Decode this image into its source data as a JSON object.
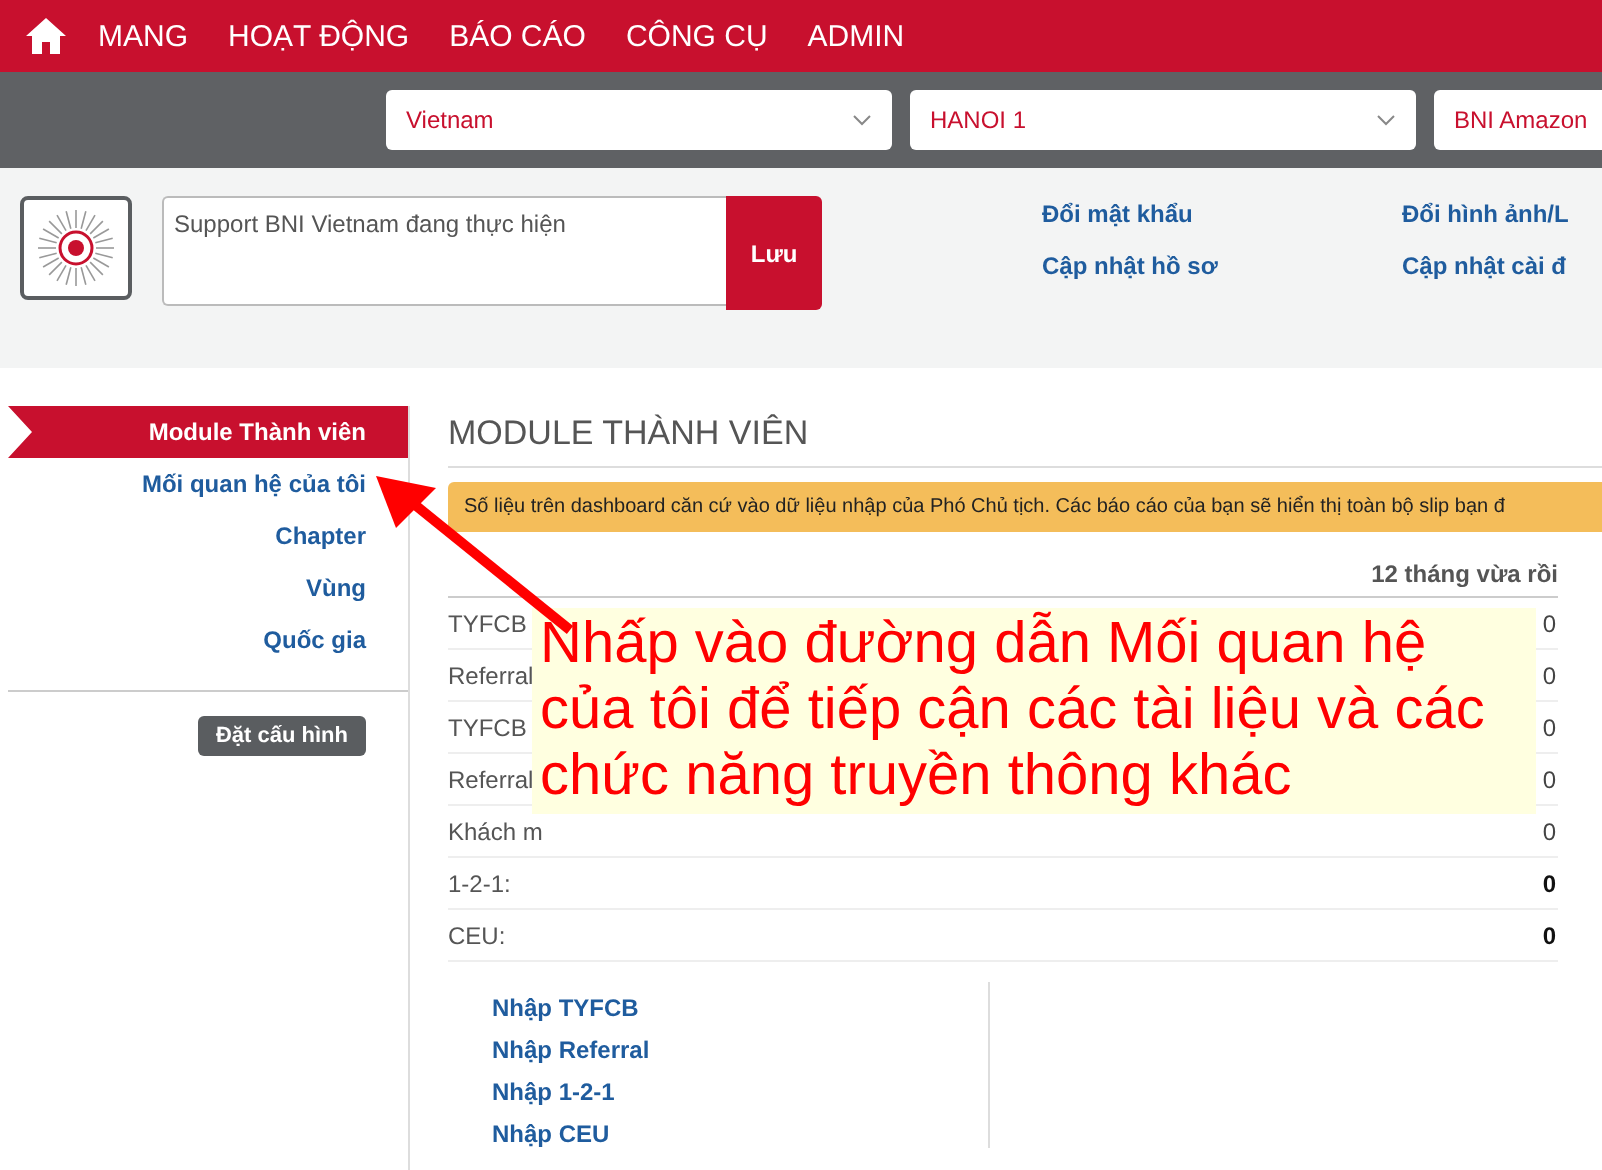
{
  "nav": {
    "items": [
      "MANG",
      "HOẠT ĐỘNG",
      "BÁO CÁO",
      "CÔNG CỤ",
      "ADMIN"
    ]
  },
  "selectors": [
    {
      "value": "Vietnam"
    },
    {
      "value": "HANOI 1"
    },
    {
      "value": "BNI Amazon"
    }
  ],
  "profile": {
    "status_value": "Support BNI Vietnam đang thực hiện",
    "save_button": "Lưu",
    "links": [
      "Đổi mật khẩu",
      "Đổi hình ảnh/L",
      "Cập nhật hồ sơ",
      "Cập nhật cài đ"
    ]
  },
  "sidebar": {
    "items": [
      {
        "label": "Module Thành viên",
        "selected": true
      },
      {
        "label": "Mối quan hệ của tôi",
        "selected": false
      },
      {
        "label": "Chapter",
        "selected": false
      },
      {
        "label": "Vùng",
        "selected": false
      },
      {
        "label": "Quốc gia",
        "selected": false
      }
    ],
    "config_button": "Đặt cấu hình"
  },
  "main": {
    "title": "MODULE THÀNH VIÊN",
    "notice": "Số liệu trên dashboard căn cứ vào dữ liệu nhập của Phó Chủ tịch. Các báo cáo của bạn sẽ hiển thị toàn bộ slip bạn đ",
    "table": {
      "column_header": "12 tháng vừa rồi",
      "rows": [
        {
          "label": "TYFCB",
          "value": "0"
        },
        {
          "label": "Referral",
          "value": "0"
        },
        {
          "label": "TYFCB",
          "value": "0"
        },
        {
          "label": "Referral",
          "value": "0"
        },
        {
          "label": "Khách m",
          "value": "0"
        },
        {
          "label": "1-2-1:",
          "value": "0"
        },
        {
          "label": "CEU:",
          "value": "0"
        }
      ]
    },
    "entry_links": [
      "Nhập TYFCB",
      "Nhập Referral",
      "Nhập 1-2-1",
      "Nhập CEU"
    ]
  },
  "annotation": {
    "text": "Nhấp vào đường dẫn Mối quan hệ của tôi để tiếp cận các tài liệu và các chức năng truyền thông khác"
  }
}
